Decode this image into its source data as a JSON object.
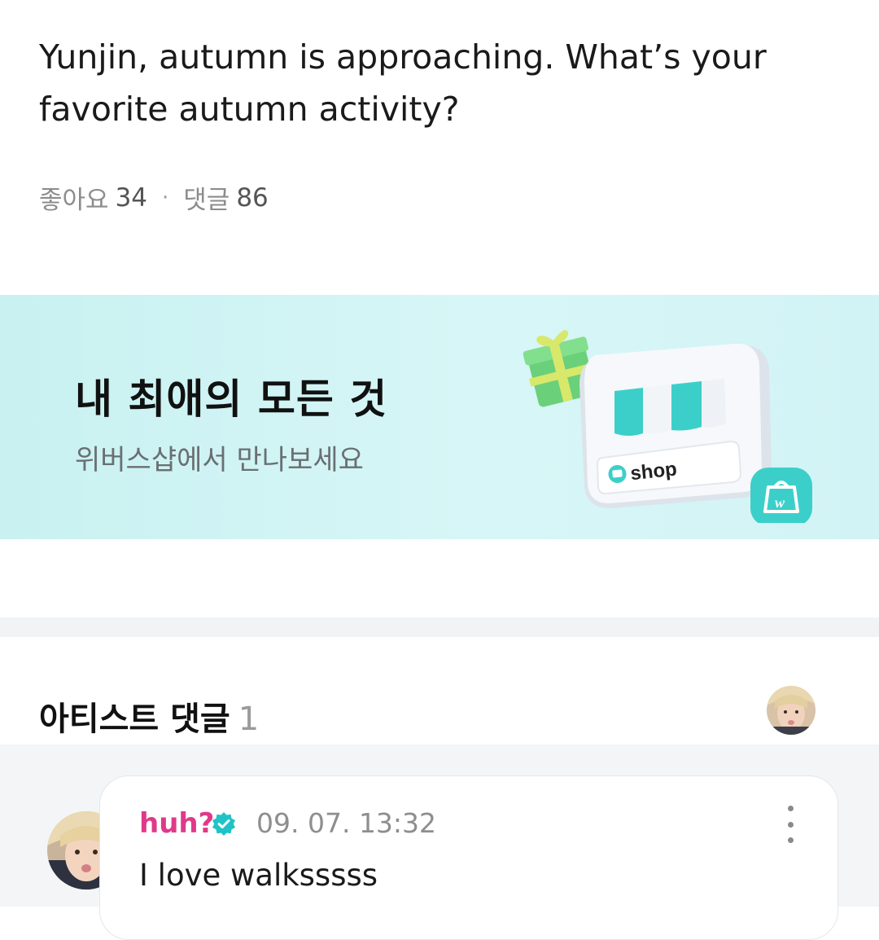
{
  "post": {
    "text": "Yunjin, autumn is approaching. What’s your favorite autumn activity?",
    "likes_label": "좋아요",
    "likes_count": "34",
    "separator": "·",
    "comments_label": "댓글",
    "comments_count": "86"
  },
  "banner": {
    "title": "내 최애의 모든 것",
    "subtitle": "위버스샵에서 만나보세요",
    "shop_label": "shop",
    "bag_letter": "w"
  },
  "artist_comments": {
    "title": "아티스트 댓글",
    "count": "1"
  },
  "comment": {
    "author": "huh?",
    "time": "09. 07. 13:32",
    "text": "I love walksssss"
  },
  "icons": {
    "verified": "verified-badge-icon",
    "more": "more-vertical-icon",
    "gift": "gift-icon",
    "shop": "shop-storefront-icon",
    "bag": "shopping-bag-icon"
  },
  "colors": {
    "banner_bg": "#cff3f4",
    "author": "#e0398a",
    "verified": "#1fc3c7",
    "accent_teal": "#3ccfca"
  }
}
